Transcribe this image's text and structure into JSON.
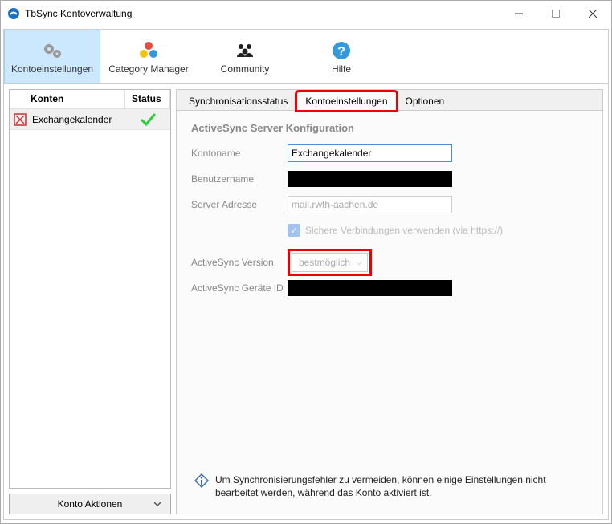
{
  "window": {
    "title": "TbSync Kontoverwaltung"
  },
  "toolbar": {
    "items": [
      {
        "label": "Kontoeinstellungen"
      },
      {
        "label": "Category Manager"
      },
      {
        "label": "Community"
      },
      {
        "label": "Hilfe"
      }
    ]
  },
  "sidebar": {
    "header": {
      "konten": "Konten",
      "status": "Status"
    },
    "rows": [
      {
        "name": "Exchangekalender"
      }
    ],
    "actions_label": "Konto Aktionen"
  },
  "tabs": [
    {
      "label": "Synchronisationsstatus"
    },
    {
      "label": "Kontoeinstellungen"
    },
    {
      "label": "Optionen"
    }
  ],
  "settings": {
    "section_title": "ActiveSync Server Konfiguration",
    "kontoname": {
      "label": "Kontoname",
      "value": "Exchangekalender"
    },
    "benutzername": {
      "label": "Benutzername"
    },
    "server": {
      "label": "Server Adresse",
      "value": "mail.rwth-aachen.de"
    },
    "secure_checkbox": {
      "label": "Sichere Verbindungen verwenden (via https://)"
    },
    "as_version": {
      "label": "ActiveSync Version",
      "value": "bestmöglich"
    },
    "device_id": {
      "label": "ActiveSync Geräte ID"
    }
  },
  "footer_note": "Um Synchronisierungsfehler zu vermeiden, können einige Einstellungen nicht bearbeitet werden, während das Konto aktiviert ist."
}
